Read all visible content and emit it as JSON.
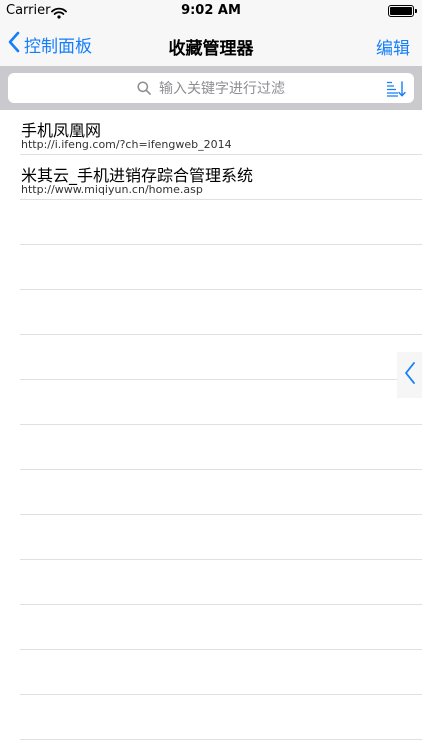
{
  "status_bar": {
    "carrier": "Carrier",
    "time": "9:02 AM"
  },
  "nav": {
    "back_label": "控制面板",
    "title": "收藏管理器",
    "edit_label": "编辑"
  },
  "search": {
    "placeholder": "输入关键字进行过滤"
  },
  "bookmarks": [
    {
      "title": "手机凤凰网",
      "url": "http://i.ifeng.com/?ch=ifengweb_2014"
    },
    {
      "title": "米其云_手机进销存踪合管理系统",
      "url": "http://www.miqiyun.cn/home.asp"
    }
  ],
  "empty_rows": 12,
  "colors": {
    "accent": "#147efb",
    "search_bg": "#c9c9ce",
    "bar_bg": "#f7f7f7"
  },
  "icons": [
    "wifi-icon",
    "battery-icon",
    "chevron-left-icon",
    "search-icon",
    "sort-icon",
    "chevron-left-icon"
  ]
}
